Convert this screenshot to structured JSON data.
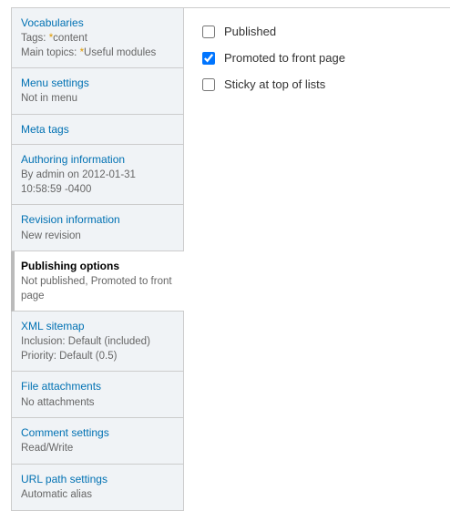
{
  "sidebar": {
    "items": [
      {
        "title": "Vocabularies",
        "summary_html": "Tags: <span class='asterisk'>*</span>content<br>Main topics: <span class='asterisk'>*</span>Useful modules"
      },
      {
        "title": "Menu settings",
        "summary": "Not in menu"
      },
      {
        "title": "Meta tags",
        "summary": ""
      },
      {
        "title": "Authoring information",
        "summary": "By admin on 2012-01-31 10:58:59 -0400"
      },
      {
        "title": "Revision information",
        "summary": "New revision"
      },
      {
        "title": "Publishing options",
        "summary": "Not published, Promoted to front page",
        "active": true
      },
      {
        "title": "XML sitemap",
        "summary": "Inclusion: Default (included)\nPriority: Default (0.5)"
      },
      {
        "title": "File attachments",
        "summary": "No attachments"
      },
      {
        "title": "Comment settings",
        "summary": "Read/Write"
      },
      {
        "title": "URL path settings",
        "summary": "Automatic alias"
      }
    ]
  },
  "panel": {
    "published": {
      "label": "Published",
      "checked": false
    },
    "promoted": {
      "label": "Promoted to front page",
      "checked": true
    },
    "sticky": {
      "label": "Sticky at top of lists",
      "checked": false
    }
  }
}
